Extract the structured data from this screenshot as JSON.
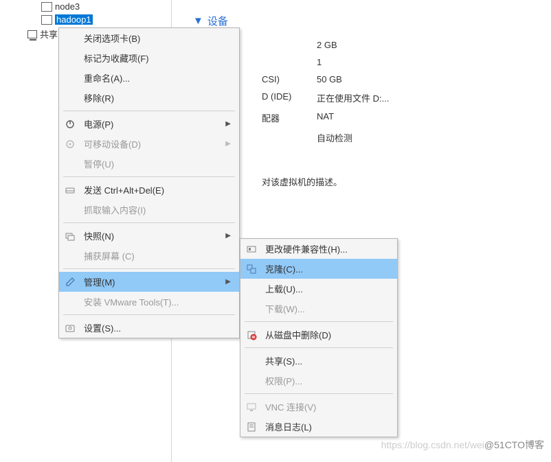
{
  "tree": {
    "node3": "node3",
    "hadoop1": "hadoop1",
    "share": "共享"
  },
  "detail": {
    "section_title": "设备",
    "rows": [
      {
        "label": "",
        "value": "2 GB"
      },
      {
        "label": "",
        "value": "1"
      },
      {
        "label": "CSI)",
        "value": "50 GB"
      },
      {
        "label": "D (IDE)",
        "value": "正在使用文件 D:..."
      },
      {
        "label": "配器",
        "value": "NAT"
      },
      {
        "label": "",
        "value": "自动检测"
      }
    ],
    "description": "对该虚拟机的描述。"
  },
  "menu1": {
    "close_tab": "关闭选项卡(B)",
    "mark_fav": "标记为收藏项(F)",
    "rename": "重命名(A)...",
    "remove": "移除(R)",
    "power": "电源(P)",
    "removable_dev": "可移动设备(D)",
    "pause": "暂停(U)",
    "send_cad": "发送 Ctrl+Alt+Del(E)",
    "grab_input": "抓取输入内容(I)",
    "snapshot": "快照(N)",
    "capture_screen": "捕获屏幕 (C)",
    "manage": "管理(M)",
    "install_tools": "安装 VMware Tools(T)...",
    "settings": "设置(S)..."
  },
  "menu2": {
    "change_hw": "更改硬件兼容性(H)...",
    "clone": "克隆(C)...",
    "upload": "上载(U)...",
    "download": "下载(W)...",
    "delete_disk": "从磁盘中删除(D)",
    "share": "共享(S)...",
    "permission": "权限(P)...",
    "vnc": "VNC 连接(V)",
    "msg_log": "消息日志(L)"
  },
  "watermark": {
    "light": "https://blog.csdn.net/wei",
    "dark": "@51CTO博客"
  }
}
